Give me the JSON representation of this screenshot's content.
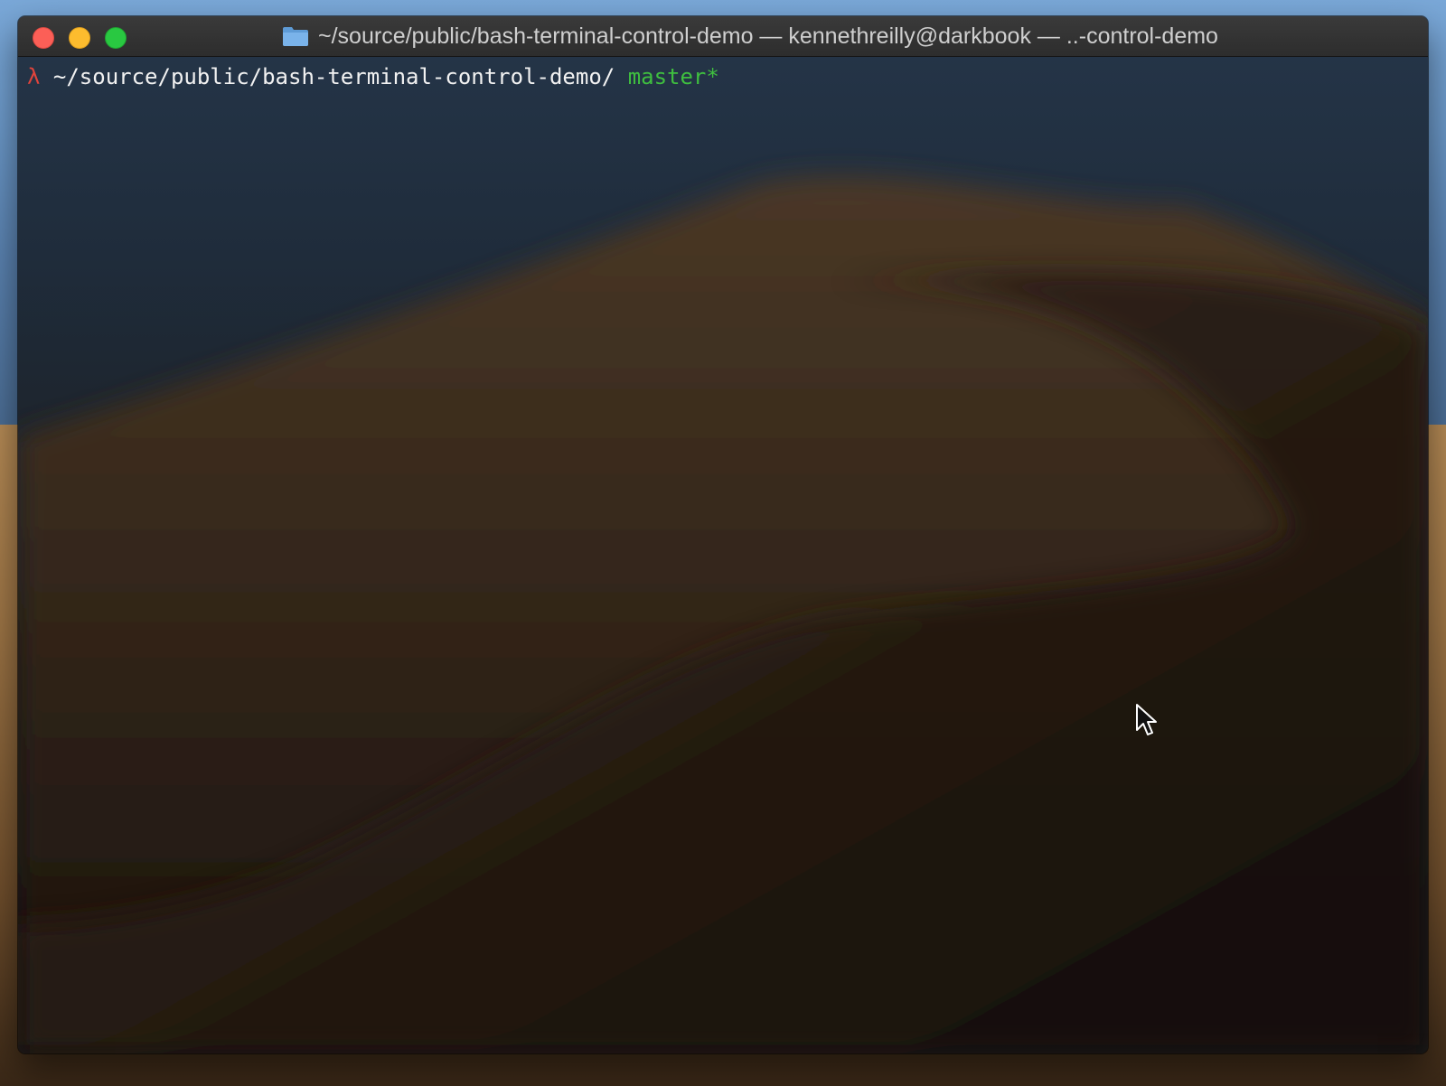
{
  "window": {
    "title": "~/source/public/bash-terminal-control-demo — kennethreilly@darkbook — ..-control-demo"
  },
  "terminal": {
    "prompt_symbol": "λ",
    "path": "~/source/public/bash-terminal-control-demo/",
    "branch": "master*"
  },
  "colors": {
    "close": "#fc5f57",
    "minimize": "#fdbc2e",
    "maximize": "#29c841",
    "prompt_symbol": "#e0443c",
    "branch": "#3fbf3f"
  },
  "icons": {
    "folder": "folder-icon",
    "pointer": "mouse-pointer-icon"
  }
}
